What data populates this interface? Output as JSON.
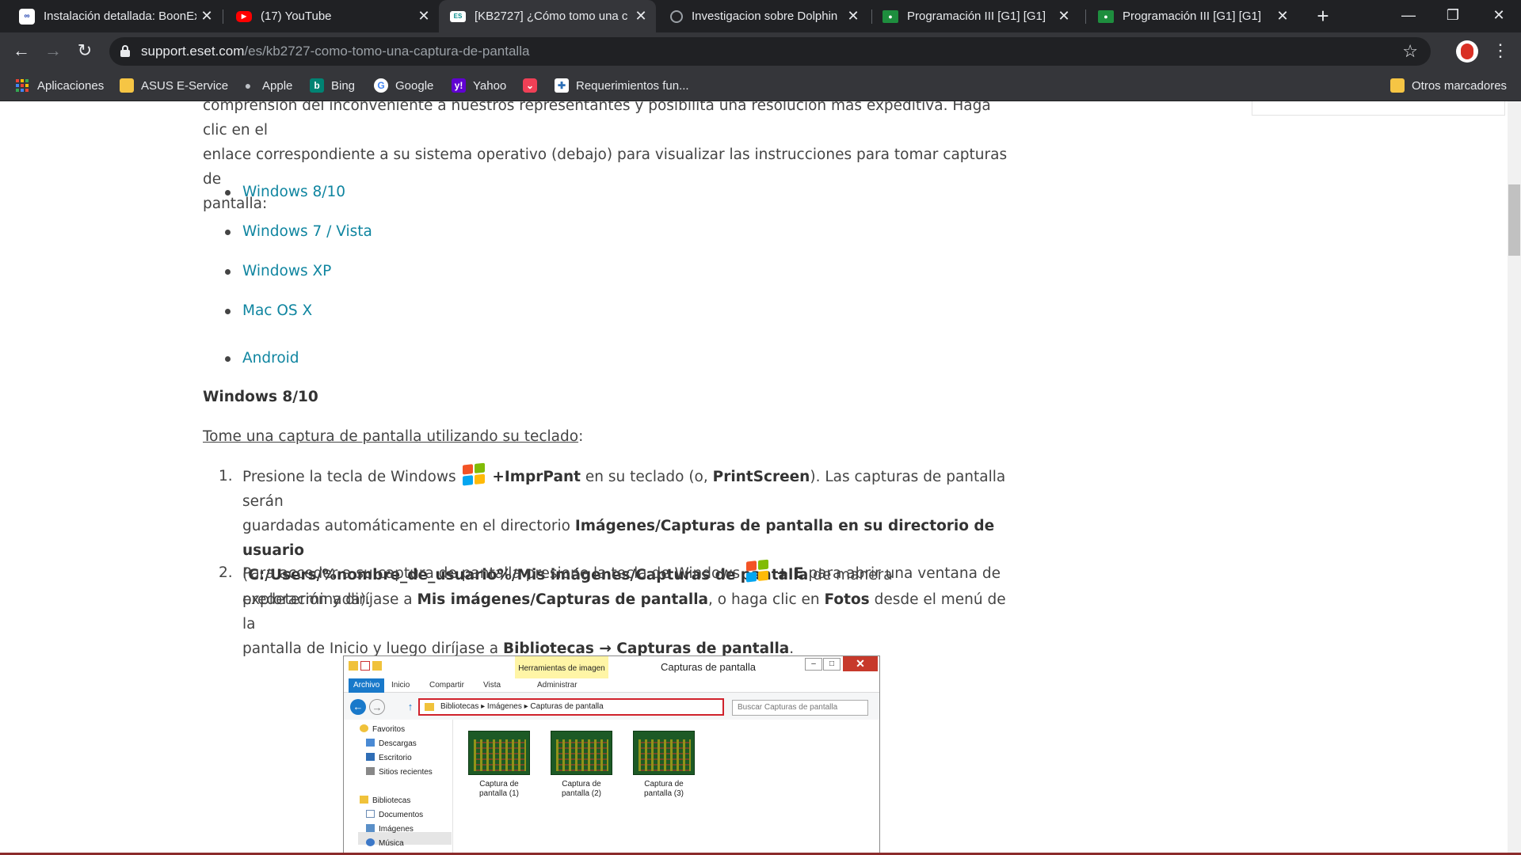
{
  "tabs": [
    {
      "title": "Instalación detallada: BoonEx",
      "favicon": "boonex-icon"
    },
    {
      "title": "(17) YouTube",
      "favicon": "youtube-icon"
    },
    {
      "title": "[KB2727] ¿Cómo tomo una c",
      "favicon": "eset-icon",
      "active": true
    },
    {
      "title": "Investigacion sobre Dolphin",
      "favicon": "globe-icon"
    },
    {
      "title": "Programación III [G1] [G1]",
      "favicon": "classroom-icon"
    },
    {
      "title": "Programación III [G1] [G1]",
      "favicon": "classroom-icon"
    }
  ],
  "address": {
    "host": "support.eset.com",
    "path": "/es/kb2727-como-tomo-una-captura-de-pantalla"
  },
  "bookmarks": [
    {
      "label": "Aplicaciones",
      "icon": "apps-grid-icon"
    },
    {
      "label": "ASUS E-Service",
      "icon": "folder-icon"
    },
    {
      "label": "Apple",
      "icon": "apple-icon"
    },
    {
      "label": "Bing",
      "icon": "bing-icon"
    },
    {
      "label": "Google",
      "icon": "google-icon"
    },
    {
      "label": "Yahoo",
      "icon": "yahoo-icon"
    },
    {
      "label": "",
      "icon": "pocket-icon"
    },
    {
      "label": "Requerimientos fun...",
      "icon": "puzzle-icon"
    }
  ],
  "other_bookmarks": "Otros marcadores",
  "article": {
    "intro_line1": "comprensión del inconveniente a nuestros representantes y posibilita una resolución más expeditiva. Haga clic en el",
    "intro_line2": "enlace correspondiente a su sistema operativo (debajo) para visualizar las instrucciones para tomar capturas de",
    "intro_line3": "pantalla:",
    "os_links": [
      "Windows 8/10",
      "Windows 7 / Vista",
      "Windows XP",
      "Mac OS X",
      "Android"
    ],
    "section_heading": "Windows 8/10",
    "subheading": "Tome una captura de pantalla utilizando su teclado",
    "subheading_colon": ":",
    "step1": {
      "num": "1.",
      "l1_a": "Presione la tecla de Windows",
      "l1_b": "+ImprPant",
      "l1_c": "en su teclado (o,",
      "l1_d": "PrintScreen",
      "l1_e": "). Las capturas de pantalla serán",
      "l2_a": "guardadas automáticamente en el directorio",
      "l2_b": "Imágenes/Capturas de pantalla en su directorio de usuario",
      "l3_a": "(",
      "l3_b": "C:/Users/%nombre_de_usuario%/Mis imágenes/Capturas de pantalla",
      "l3_c": "de manera predeterminada)."
    },
    "step2": {
      "num": "2.",
      "l1_a": "Para acceder a su captura de pantalla presione la tecla de Windows",
      "l1_b": "+ E",
      "l1_c": "para abrir una ventana de",
      "l2_a": "exploración y diríjase a",
      "l2_b": "Mis imágenes/Capturas de pantalla",
      "l2_c": ", o haga clic en",
      "l2_d": "Fotos",
      "l2_e": "desde el menú de la",
      "l3_a": "pantalla de Inicio y luego diríjase a",
      "l3_b": "Bibliotecas → Capturas de pantalla",
      "l3_c": "."
    }
  },
  "explorer": {
    "title": "Capturas de pantalla",
    "tool_tab": "Herramientas de imagen",
    "ribbon_tabs": [
      "Archivo",
      "Inicio",
      "Compartir",
      "Vista",
      "Administrar"
    ],
    "breadcrumb": "Bibliotecas  ▸  Imágenes  ▸  Capturas de pantalla",
    "search_placeholder": "Buscar Capturas de pantalla",
    "nav": [
      "Favoritos",
      "Descargas",
      "Escritorio",
      "Sitios recientes",
      "Bibliotecas",
      "Documentos",
      "Imágenes",
      "Música"
    ],
    "thumbs": [
      "Captura de pantalla (1)",
      "Captura de pantalla (2)",
      "Captura de pantalla (3)"
    ]
  },
  "colors": {
    "link": "#0f85a0",
    "chrome_dark": "#202124",
    "chrome_mid": "#35363a",
    "red_border": "#d0222c"
  }
}
